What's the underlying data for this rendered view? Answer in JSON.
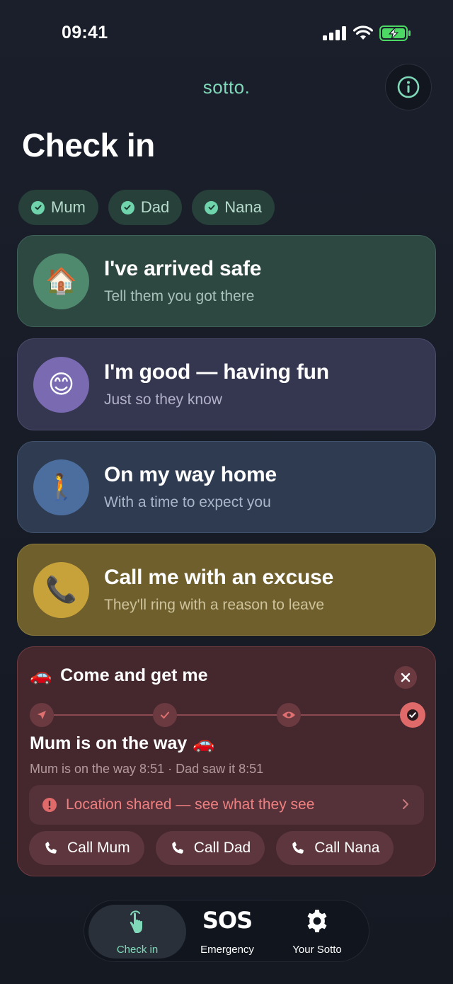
{
  "status": {
    "time": "09:41"
  },
  "header": {
    "brand": "sotto.",
    "title": "Check in"
  },
  "chips": [
    {
      "label": "Mum"
    },
    {
      "label": "Dad"
    },
    {
      "label": "Nana"
    }
  ],
  "cards": {
    "arrived": {
      "emoji": "🏠",
      "title": "I've arrived safe",
      "sub": "Tell them you got there"
    },
    "good": {
      "emoji": "😊",
      "title": "I'm good — having fun",
      "sub": "Just so they know"
    },
    "home": {
      "emoji": "🚶",
      "title": "On my way home",
      "sub": "With a time to expect you"
    },
    "call": {
      "emoji": "📞",
      "title": "Call me with an excuse",
      "sub": "They'll ring with a reason to leave"
    }
  },
  "rescue": {
    "emoji": "🚗",
    "title": "Come and get me",
    "status": "Mum is on the way",
    "status_emoji": "🚗",
    "meta": "Mum is on the way 8:51 · Dad saw it 8:51",
    "location": "Location shared — see what they see",
    "calls": [
      {
        "label": "Call Mum"
      },
      {
        "label": "Call Dad"
      },
      {
        "label": "Call Nana"
      }
    ]
  },
  "tabs": [
    {
      "label": "Check in"
    },
    {
      "icon": "SOS",
      "label": "Emergency"
    },
    {
      "label": "Your Sotto"
    }
  ],
  "colors": {
    "accent": "#7fd9b8",
    "danger": "#e06a6a",
    "background": "#1a1f2b"
  }
}
